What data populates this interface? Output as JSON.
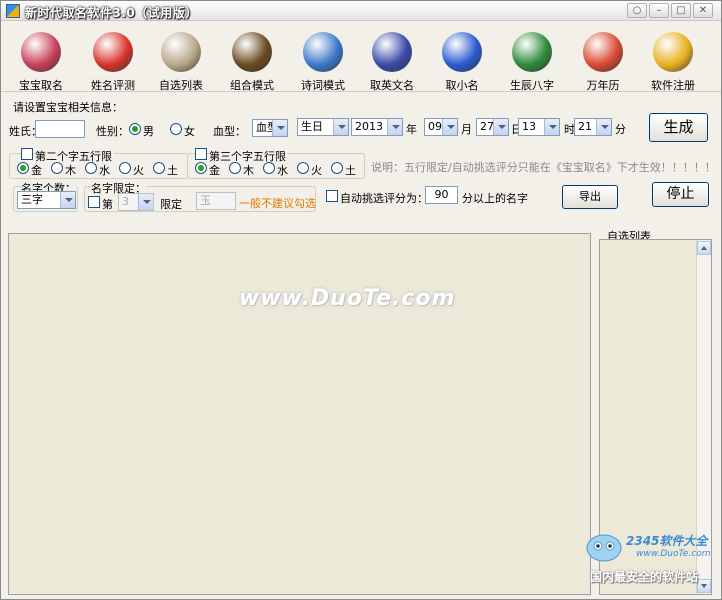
{
  "window": {
    "title": "新时代取名软件3.0（试用版）"
  },
  "toolbar": [
    {
      "label": "宝宝取名",
      "icon": "baby-icon",
      "color": "#c8405a"
    },
    {
      "label": "姓名评测",
      "icon": "flower-icon",
      "color": "#d8332a"
    },
    {
      "label": "自选列表",
      "icon": "brush-cup-icon",
      "color": "#b8a88a"
    },
    {
      "label": "组合模式",
      "icon": "eagle-icon",
      "color": "#6a4a20"
    },
    {
      "label": "诗词模式",
      "icon": "book-icon",
      "color": "#3a78c8"
    },
    {
      "label": "取英文名",
      "icon": "badge-icon",
      "color": "#3a4aa8"
    },
    {
      "label": "取小名",
      "icon": "spirit-icon",
      "color": "#2a5ad0"
    },
    {
      "label": "生辰八字",
      "icon": "bagua-icon",
      "color": "#2e8a3a"
    },
    {
      "label": "万年历",
      "icon": "calendar-icon",
      "color": "#d84830"
    },
    {
      "label": "软件注册",
      "icon": "lock-icon",
      "color": "#e8b020"
    }
  ],
  "form": {
    "section_label": "请设置宝宝相关信息：",
    "surname_label": "姓氏：",
    "surname_value": "",
    "gender_label": "性别：",
    "gender_male": "男",
    "gender_female": "女",
    "blood_label": "血型：",
    "blood_value": "血型",
    "date_type": "生日",
    "year": "2013",
    "year_unit": "年",
    "month": "09",
    "month_unit": "月",
    "day": "27",
    "day_unit": "日",
    "hour": "13",
    "hour_unit": "时",
    "minute": "21",
    "minute_unit": "分",
    "generate": "生成"
  },
  "wuxing2": {
    "title": "第二个字五行限",
    "options": [
      "金",
      "木",
      "水",
      "火",
      "土"
    ]
  },
  "wuxing3": {
    "title": "第三个字五行限",
    "options": [
      "金",
      "木",
      "水",
      "火",
      "土"
    ]
  },
  "note": "说明：五行限定/自动挑选评分只能在《宝宝取名》下才生效！！！！！",
  "count": {
    "title": "名字个数：",
    "value": "三字"
  },
  "limit": {
    "title": "名字限定：",
    "prefix": "第",
    "position": "3",
    "suffix": "限定",
    "char_value": "玉",
    "hint": "一般不建议勾选"
  },
  "auto": {
    "label": "自动挑选评分为：",
    "score": "90",
    "suffix": "分以上的名字",
    "export": "导出",
    "stop": "停止"
  },
  "list": {
    "title": "自选列表"
  },
  "watermark": "www.DuoTe.com",
  "badge": {
    "brand": "2345软件大全",
    "site": "www.DuoTe.com",
    "slogan": "国内最安全的软件站"
  }
}
